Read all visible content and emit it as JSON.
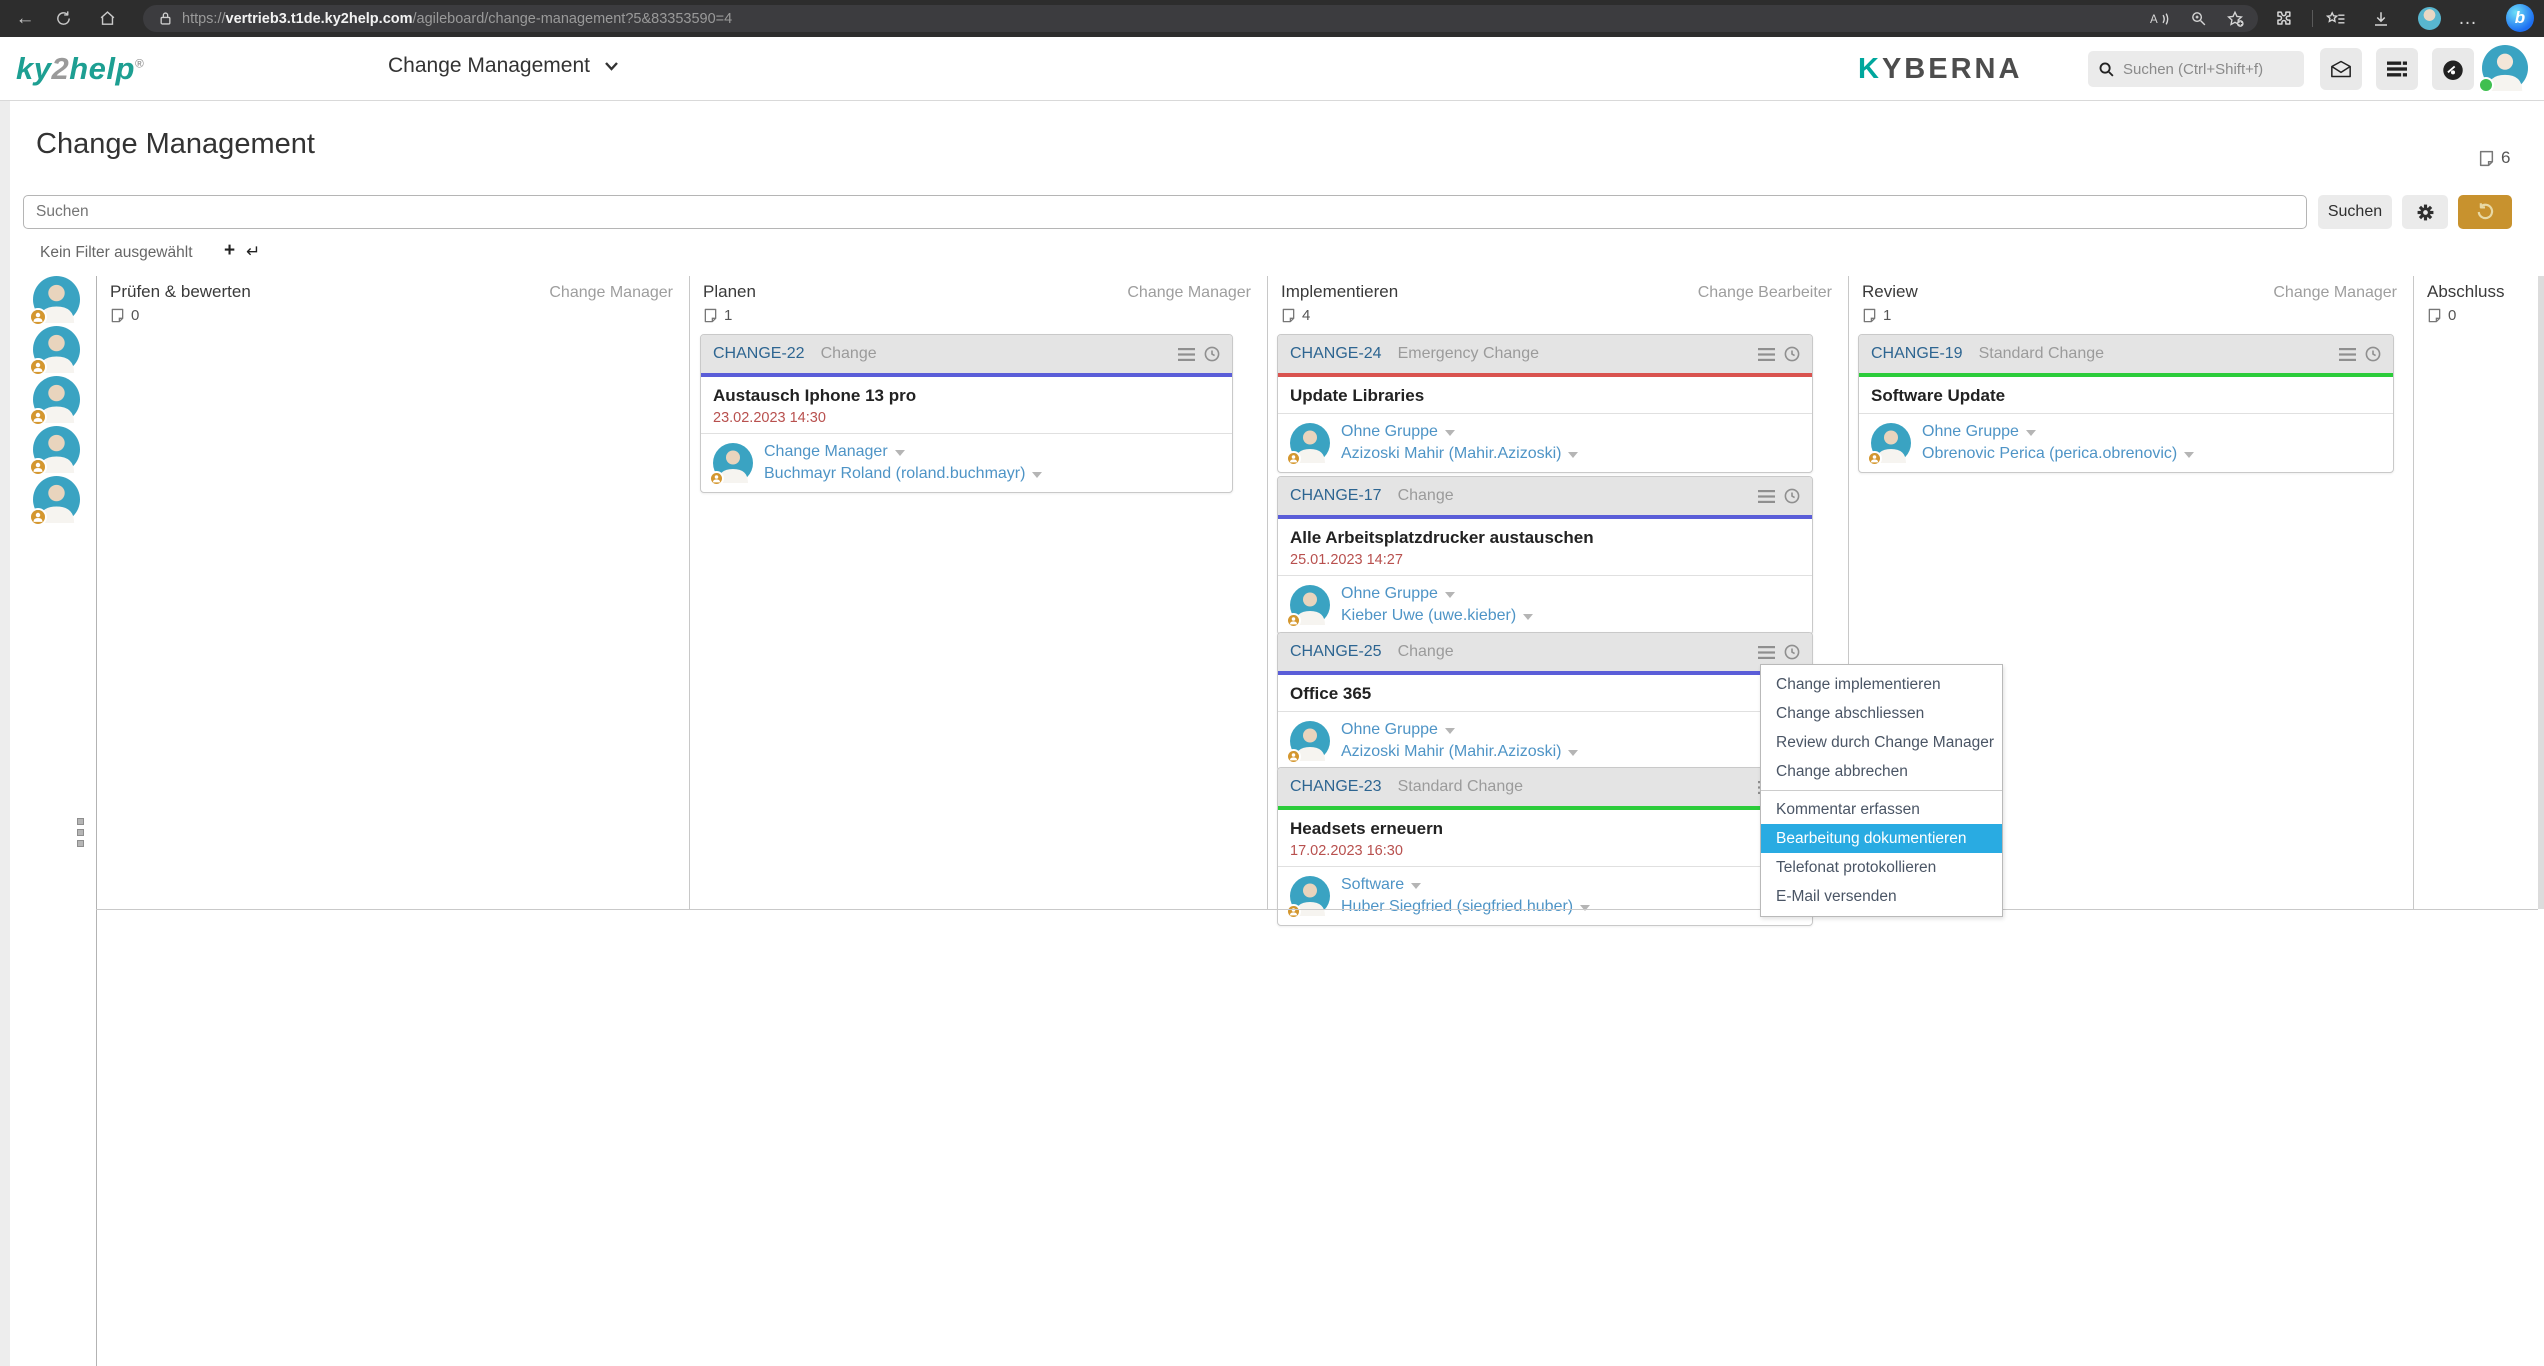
{
  "browser": {
    "url_scheme": "https://",
    "url_domain": "vertrieb3.t1de.ky2help.com",
    "url_path": "/agileboard/change-management?5&83353590=4",
    "back_glyph": "←",
    "ellipsis_glyph": "…",
    "bing_glyph": "b"
  },
  "app_header": {
    "logo_part1": "ky",
    "logo_part2": "2",
    "logo_part3": "help",
    "logo_reg": "®",
    "nav_title": "Change Management",
    "brand": "KYBERNA",
    "search_placeholder": "Suchen (Ctrl+Shift+f)"
  },
  "page": {
    "title": "Change Management",
    "total_count": "6",
    "search_placeholder": "Suchen",
    "search_button_label": "Suchen",
    "filter_status": "Kein Filter ausgewählt",
    "filter_plus_glyph": "+",
    "filter_enter_glyph": "↵"
  },
  "board": {
    "columns": [
      {
        "name": "Prüfen & bewerten",
        "role": "Change Manager",
        "count": "0",
        "cards": []
      },
      {
        "name": "Planen",
        "role": "Change Manager",
        "count": "1",
        "cards": [
          {
            "id": "CHANGE-22",
            "type": "Change",
            "title": "Austausch Iphone 13 pro",
            "date": "23.02.2023 14:30",
            "group": "Change Manager",
            "person": "Buchmayr Roland (roland.buchmayr)",
            "accent": "#5a5dd8"
          }
        ]
      },
      {
        "name": "Implementieren",
        "role": "Change Bearbeiter",
        "count": "4",
        "cards": [
          {
            "id": "CHANGE-24",
            "type": "Emergency Change",
            "title": "Update Libraries",
            "group": "Ohne Gruppe",
            "person": "Azizoski Mahir (Mahir.Azizoski)",
            "accent": "#d9534f"
          },
          {
            "id": "CHANGE-17",
            "type": "Change",
            "title": "Alle Arbeitsplatzdrucker austauschen",
            "date": "25.01.2023 14:27",
            "group": "Ohne Gruppe",
            "person": "Kieber Uwe (uwe.kieber)",
            "accent": "#5a5dd8"
          },
          {
            "id": "CHANGE-25",
            "type": "Change",
            "title": "Office 365",
            "group": "Ohne Gruppe",
            "person": "Azizoski Mahir (Mahir.Azizoski)",
            "accent": "#5a5dd8"
          },
          {
            "id": "CHANGE-23",
            "type": "Standard Change",
            "title": "Headsets erneuern",
            "date": "17.02.2023 16:30",
            "group": "Software",
            "person": "Huber Siegfried (siegfried.huber)",
            "accent": "#2bcc3a"
          }
        ]
      },
      {
        "name": "Review",
        "role": "Change Manager",
        "count": "1",
        "cards": [
          {
            "id": "CHANGE-19",
            "type": "Standard Change",
            "title": "Software Update",
            "group": "Ohne Gruppe",
            "person": "Obrenovic Perica (perica.obrenovic)",
            "accent": "#2bcc3a"
          }
        ]
      },
      {
        "name": "Abschluss",
        "role": "",
        "count": "0",
        "cards": []
      }
    ]
  },
  "context_menu": {
    "items": [
      {
        "label": "Change implementieren"
      },
      {
        "label": "Change abschliessen"
      },
      {
        "label": "Review durch Change Manager"
      },
      {
        "label": "Change abbrechen"
      },
      {
        "label": "Kommentar erfassen"
      },
      {
        "label": "Bearbeitung dokumentieren"
      },
      {
        "label": "Telefonat protokollieren"
      },
      {
        "label": "E-Mail versenden"
      }
    ],
    "highlighted_item": "Bearbeitung dokumentieren"
  },
  "colors": {
    "accent_change": "#5a5dd8",
    "accent_emergency": "#d9534f",
    "accent_standard": "#2bcc3a",
    "menu_highlight": "#29abe2",
    "undo_button": "#c8922e",
    "brand_teal": "#1d9f92",
    "link_blue": "#4e94c6",
    "card_id_blue": "#2d6591",
    "date_red": "#b8504e",
    "avatar_teal": "#3aa3c2",
    "status_green": "#3fbf4f",
    "badge_gold": "#d4972f"
  }
}
